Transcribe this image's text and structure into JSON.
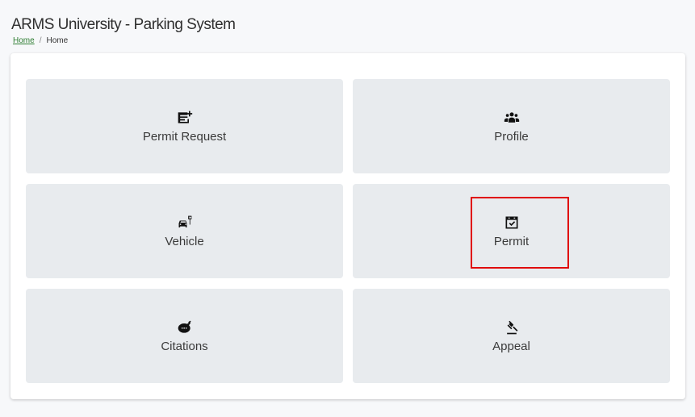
{
  "header": {
    "title": "ARMS University - Parking System"
  },
  "breadcrumb": {
    "home_link": "Home",
    "separator": "/",
    "current": "Home"
  },
  "tiles": [
    {
      "label": "Permit Request",
      "icon": "note-add-icon"
    },
    {
      "label": "Profile",
      "icon": "users-icon"
    },
    {
      "label": "Vehicle",
      "icon": "car-parking-icon"
    },
    {
      "label": "Permit",
      "icon": "calendar-check-icon"
    },
    {
      "label": "Citations",
      "icon": "citation-icon"
    },
    {
      "label": "Appeal",
      "icon": "gavel-icon"
    }
  ],
  "colors": {
    "tile_bg": "#e8ebee",
    "highlight": "#e00000",
    "link": "#2e7d32"
  }
}
